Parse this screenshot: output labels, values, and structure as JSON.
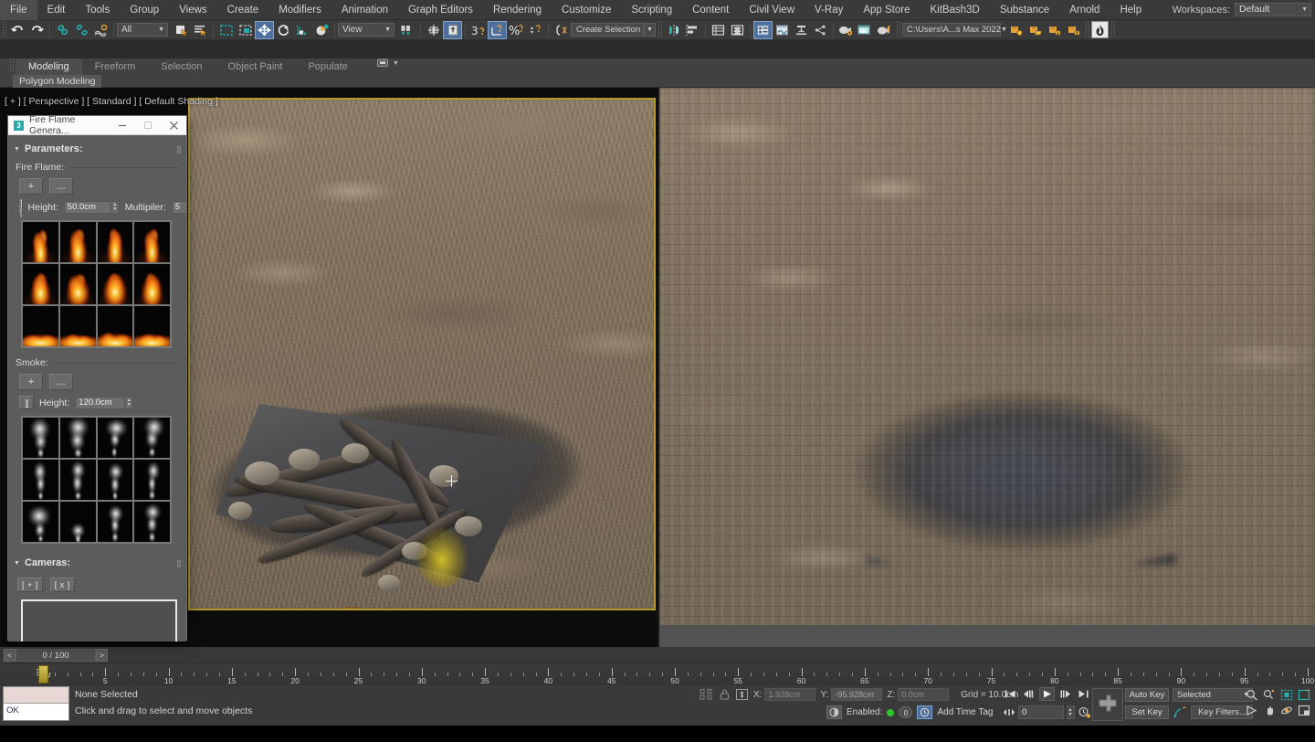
{
  "menu": {
    "items": [
      "File",
      "Edit",
      "Tools",
      "Group",
      "Views",
      "Create",
      "Modifiers",
      "Animation",
      "Graph Editors",
      "Rendering",
      "Customize",
      "Scripting",
      "Content",
      "Civil View",
      "V-Ray",
      "App Store",
      "KitBash3D",
      "Substance",
      "Arnold",
      "Help"
    ],
    "workspaces_label": "Workspaces:",
    "workspaces_value": "Default"
  },
  "toolbar": {
    "selection_filter": "All",
    "reference_coord": "View",
    "selection_set_placeholder": "Create Selection Se",
    "project_path": "C:\\Users\\A...s Max 2022",
    "icons": [
      "undo-icon",
      "redo-icon",
      "select-link-icon",
      "unlink-icon",
      "bind-spacewarp-icon",
      "select-object-icon",
      "select-by-name-icon",
      "rect-selection-region-icon",
      "window-crossing-icon",
      "select-and-move-icon",
      "select-and-rotate-icon",
      "select-and-scale-icon",
      "placement-tool-icon",
      "mirror-icon",
      "align-icon",
      "percent-snap-icon",
      "angle-snap-icon",
      "spinner-snap-icon",
      "named-selection-sets-icon",
      "mirror-geometry-icon",
      "align-objects-icon",
      "layer-explorer-icon",
      "scene-explorer-icon",
      "curve-editor-icon",
      "schematic-view-icon",
      "material-editor-icon",
      "render-setup-icon",
      "rendered-frame-icon",
      "render-production-icon",
      "save-file-icon",
      "open-folder-icon",
      "import-icon",
      "export-icon",
      "fire-flame-generator-icon"
    ]
  },
  "ribbon": {
    "tabs": [
      "Modeling",
      "Freeform",
      "Selection",
      "Object Paint",
      "Populate"
    ],
    "active_tab": "Modeling",
    "subtab": "Polygon Modeling"
  },
  "viewport": {
    "label": "[ + ] [ Perspective ] [ Standard ] [ Default Shading ]"
  },
  "ffg": {
    "title": "Fire Flame Genera...",
    "window_buttons": [
      "minimize-button",
      "maximize-button",
      "close-button"
    ],
    "rollouts": {
      "parameters": "Parameters:",
      "cameras": "Cameras:"
    },
    "fire_flame": {
      "group_label": "Fire Flame:",
      "add_button": "+",
      "browse_button": "...",
      "range_button": "][",
      "height_label": "Height:",
      "height_value": "50.0cm",
      "multiplier_label": "Multipiler:",
      "multiplier_value": "5",
      "thumb_count": 12
    },
    "smoke": {
      "group_label": "Smoke:",
      "add_button": "+",
      "browse_button": "...",
      "range_button": "][",
      "height_label": "Height:",
      "height_value": "120.0cm",
      "thumb_count": 12
    },
    "cameras": {
      "add_button": "[ + ]",
      "remove_button": "[ x ]",
      "list_items": []
    }
  },
  "timeline": {
    "prev_button": "<",
    "next_button": ">",
    "frame_field": "0 / 100",
    "tick_labels": [
      "5",
      "10",
      "15",
      "20",
      "25",
      "30",
      "35",
      "40",
      "45",
      "50",
      "55",
      "60",
      "65",
      "70",
      "75",
      "80",
      "85",
      "90",
      "95",
      "100"
    ],
    "range_start": 0,
    "range_end": 100
  },
  "status": {
    "message_ok": "OK",
    "selection": "None Selected",
    "hint": "Click and drag to select and move objects",
    "x_label": "X:",
    "x_value": "1.928cm",
    "y_label": "Y:",
    "y_value": "-95.928cm",
    "z_label": "Z:",
    "z_value": "0.0cm",
    "grid": "Grid = 10.0cm",
    "enabled_label": "Enabled:",
    "key_count": "0",
    "add_time_tag": "Add Time Tag",
    "auto_key": "Auto Key",
    "set_key": "Set Key",
    "key_mode": "Selected",
    "key_filters": "Key Filters...",
    "current_frame": "0"
  },
  "colors": {
    "accent_blue": "#4e6f9c",
    "teal": "#23b0ad",
    "gold": "#b79b2c",
    "orange": "#e8a33d",
    "panel_bg": "#5c5c5c",
    "toolbar_bg": "#3a3a3a"
  }
}
